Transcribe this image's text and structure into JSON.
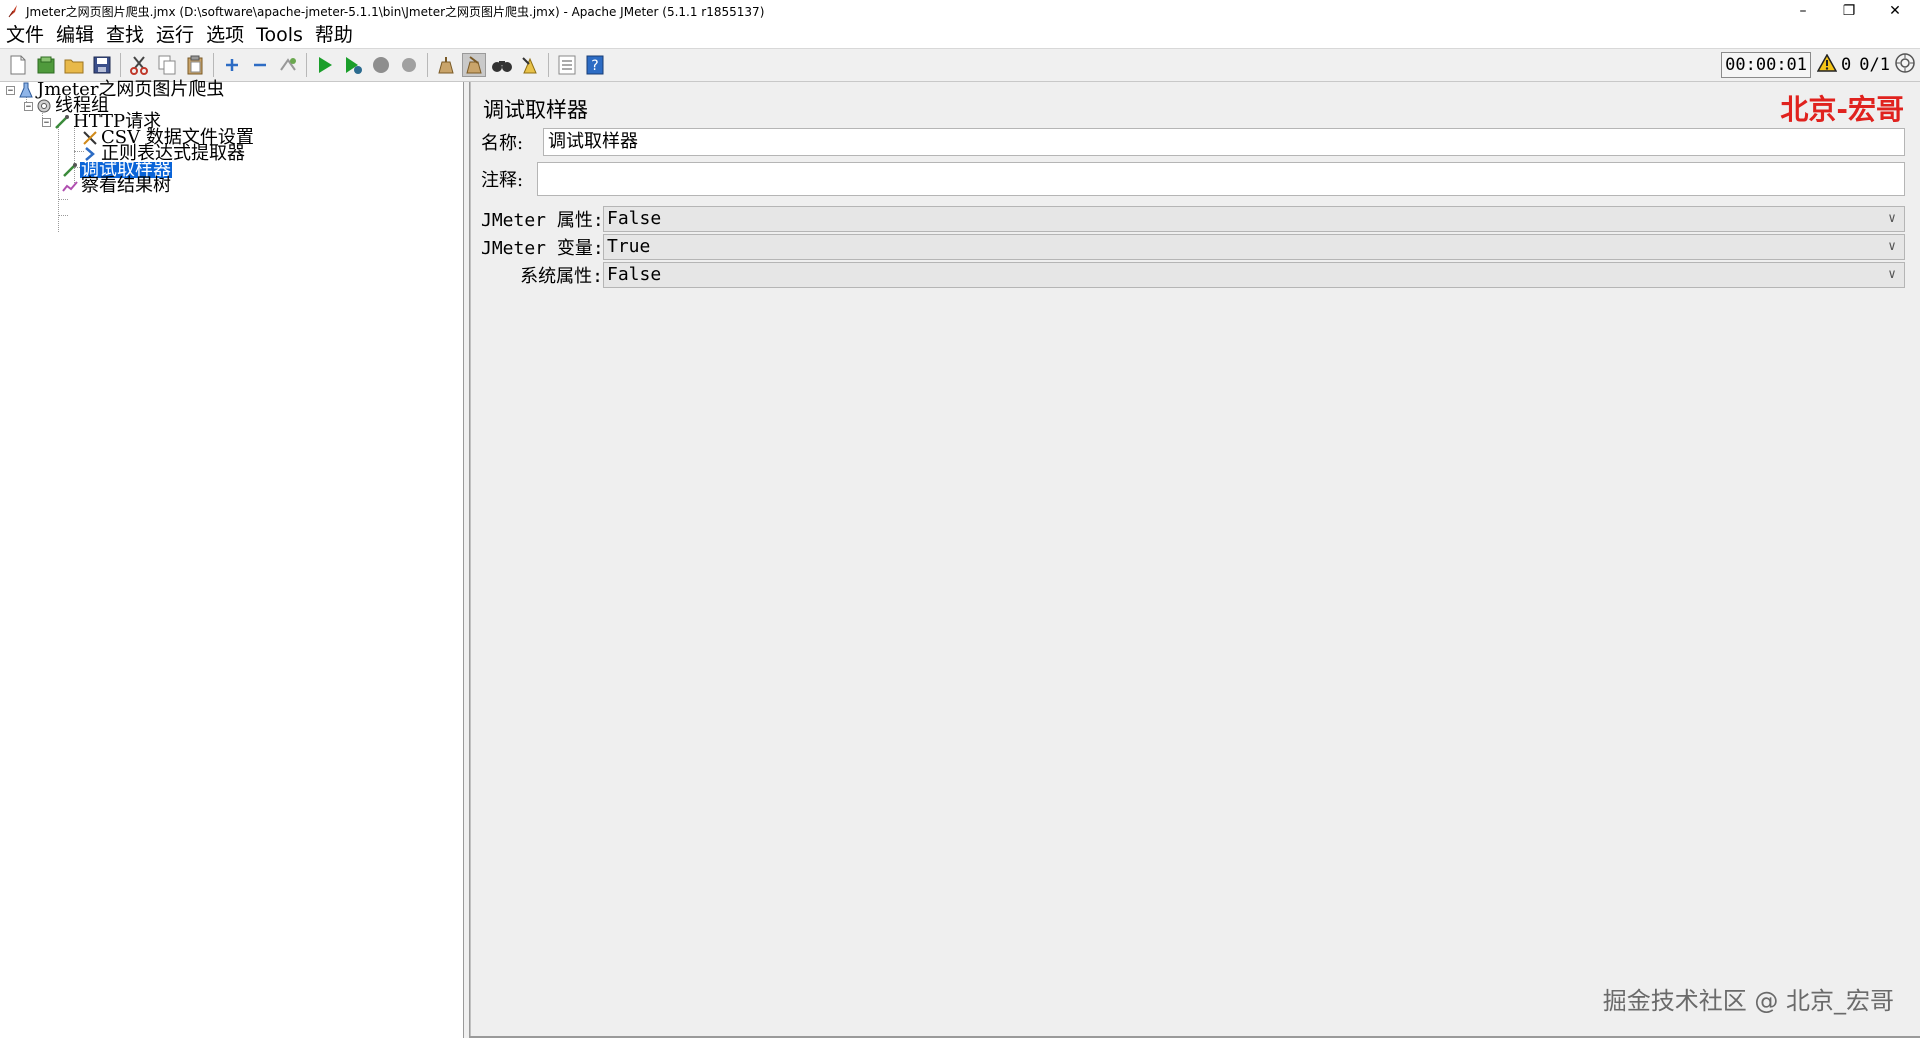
{
  "window": {
    "title": "Jmeter之网页图片爬虫.jmx (D:\\software\\apache-jmeter-5.1.1\\bin\\Jmeter之网页图片爬虫.jmx) - Apache JMeter (5.1.1 r1855137)",
    "minimize": "–",
    "restore": "❐",
    "close": "✕"
  },
  "menu": [
    "文件",
    "编辑",
    "查找",
    "运行",
    "选项",
    "Tools",
    "帮助"
  ],
  "toolbar": {
    "timer": "00:00:01",
    "warning_count": "0",
    "threads": "0/1"
  },
  "tree": {
    "nodes": [
      {
        "label": "Jmeter之网页图片爬虫"
      },
      {
        "label": "线程组"
      },
      {
        "label": "HTTP请求"
      },
      {
        "label": "CSV 数据文件设置"
      },
      {
        "label": "正则表达式提取器"
      },
      {
        "label": "调试取样器"
      },
      {
        "label": "察看结果树"
      }
    ],
    "expander_minus": "−"
  },
  "panel": {
    "title": "调试取样器",
    "watermark_top": "北京-宏哥",
    "name_label": "名称:",
    "name_value": "调试取样器",
    "comment_label": "注释:",
    "comment_value": "",
    "props": [
      {
        "label": "JMeter 属性:",
        "value": "False"
      },
      {
        "label": "JMeter 变量:",
        "value": "True"
      },
      {
        "label": "系统属性:",
        "value": "False"
      }
    ],
    "watermark_bottom": "掘金技术社区 @ 北京_宏哥"
  },
  "colors": {
    "selection": "#0a64d8",
    "watermark_red": "#e0221e",
    "run_green": "#1a9e2a"
  }
}
